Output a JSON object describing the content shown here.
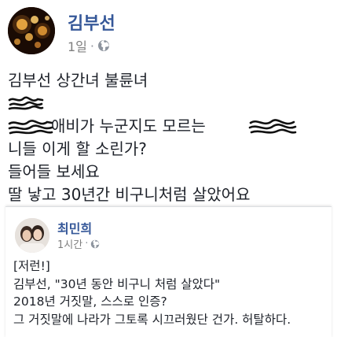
{
  "post": {
    "author": "김부선",
    "timestamp": "1일",
    "separator": "·",
    "privacy_icon": "globe-icon",
    "lines": [
      "김부선 상간녀 불륜녀",
      "",
      "애비가 누군지도 모르는",
      "니들 이게 할 소린가?",
      "들어들 보세요",
      "딸 낳고 30년간 비구니처럼 살았어요"
    ]
  },
  "shared_post": {
    "author": "최민희",
    "timestamp": "1시간",
    "separator": "·",
    "privacy_icon": "globe-icon",
    "lines": [
      "[저런!]",
      "김부선, \"30년 동안 비구니 처럼 살았다\"",
      "2018년 거짓말, 스스로 인증?",
      "그 거짓말에 나라가 그토록 시끄러웠단 건가. 허탈하다."
    ]
  },
  "colors": {
    "name_link": "#365899",
    "meta_gray": "#7f7f7f",
    "text": "#1d2129",
    "redaction_ink": "#111111"
  }
}
